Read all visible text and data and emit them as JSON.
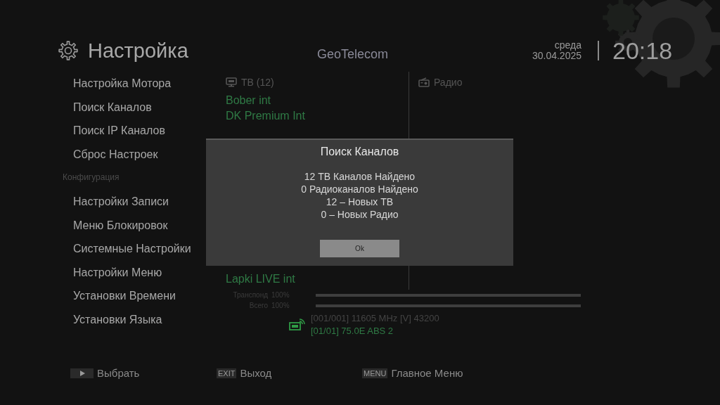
{
  "header": {
    "title": "Настройка",
    "provider": "GeoTelecom",
    "weekday": "среда",
    "date": "30.04.2025",
    "time": "20:18"
  },
  "menu": [
    {
      "kind": "item",
      "label": "Настройка Мотора"
    },
    {
      "kind": "item",
      "label": "Поиск Каналов"
    },
    {
      "kind": "item",
      "label": "Поиск IP Каналов"
    },
    {
      "kind": "item",
      "label": "Сброс Настроек"
    },
    {
      "kind": "heading",
      "label": "Конфигурация"
    },
    {
      "kind": "item",
      "label": "Настройки Записи"
    },
    {
      "kind": "item",
      "label": "Меню Блокировок"
    },
    {
      "kind": "item",
      "label": "Системные Настройки"
    },
    {
      "kind": "item",
      "label": "Настройки Меню"
    },
    {
      "kind": "item",
      "label": "Установки Времени"
    },
    {
      "kind": "item",
      "label": "Установки Языка"
    }
  ],
  "tv_list": {
    "title": "ТВ (12)",
    "channels": [
      "Bober int",
      "DK Premium Int",
      "Lapki LIVE int"
    ]
  },
  "radio_list": {
    "title": "Радио"
  },
  "signal": [
    {
      "label": "Транспонд",
      "reading": "100%",
      "level": 1.0
    },
    {
      "label": "Всего",
      "reading": "100%",
      "level": 1.0
    }
  ],
  "transponder": "[001/001] 11605 MHz [V] 43200",
  "satellite": "[01/01] 75.0E ABS 2",
  "dialog": {
    "title": "Поиск Каналов",
    "lines": [
      "12 ТВ Каналов Найдено",
      "0 Радиоканалов Найдено",
      "12 – Новых ТВ",
      "0 – Новых Радио"
    ],
    "button": "Ok"
  },
  "footer": [
    {
      "kind": "play",
      "label": "Выбрать"
    },
    {
      "kind": "key",
      "key": "EXIT",
      "label": "Выход"
    },
    {
      "kind": "key",
      "key": "MENU",
      "label": "Главное Меню"
    }
  ]
}
